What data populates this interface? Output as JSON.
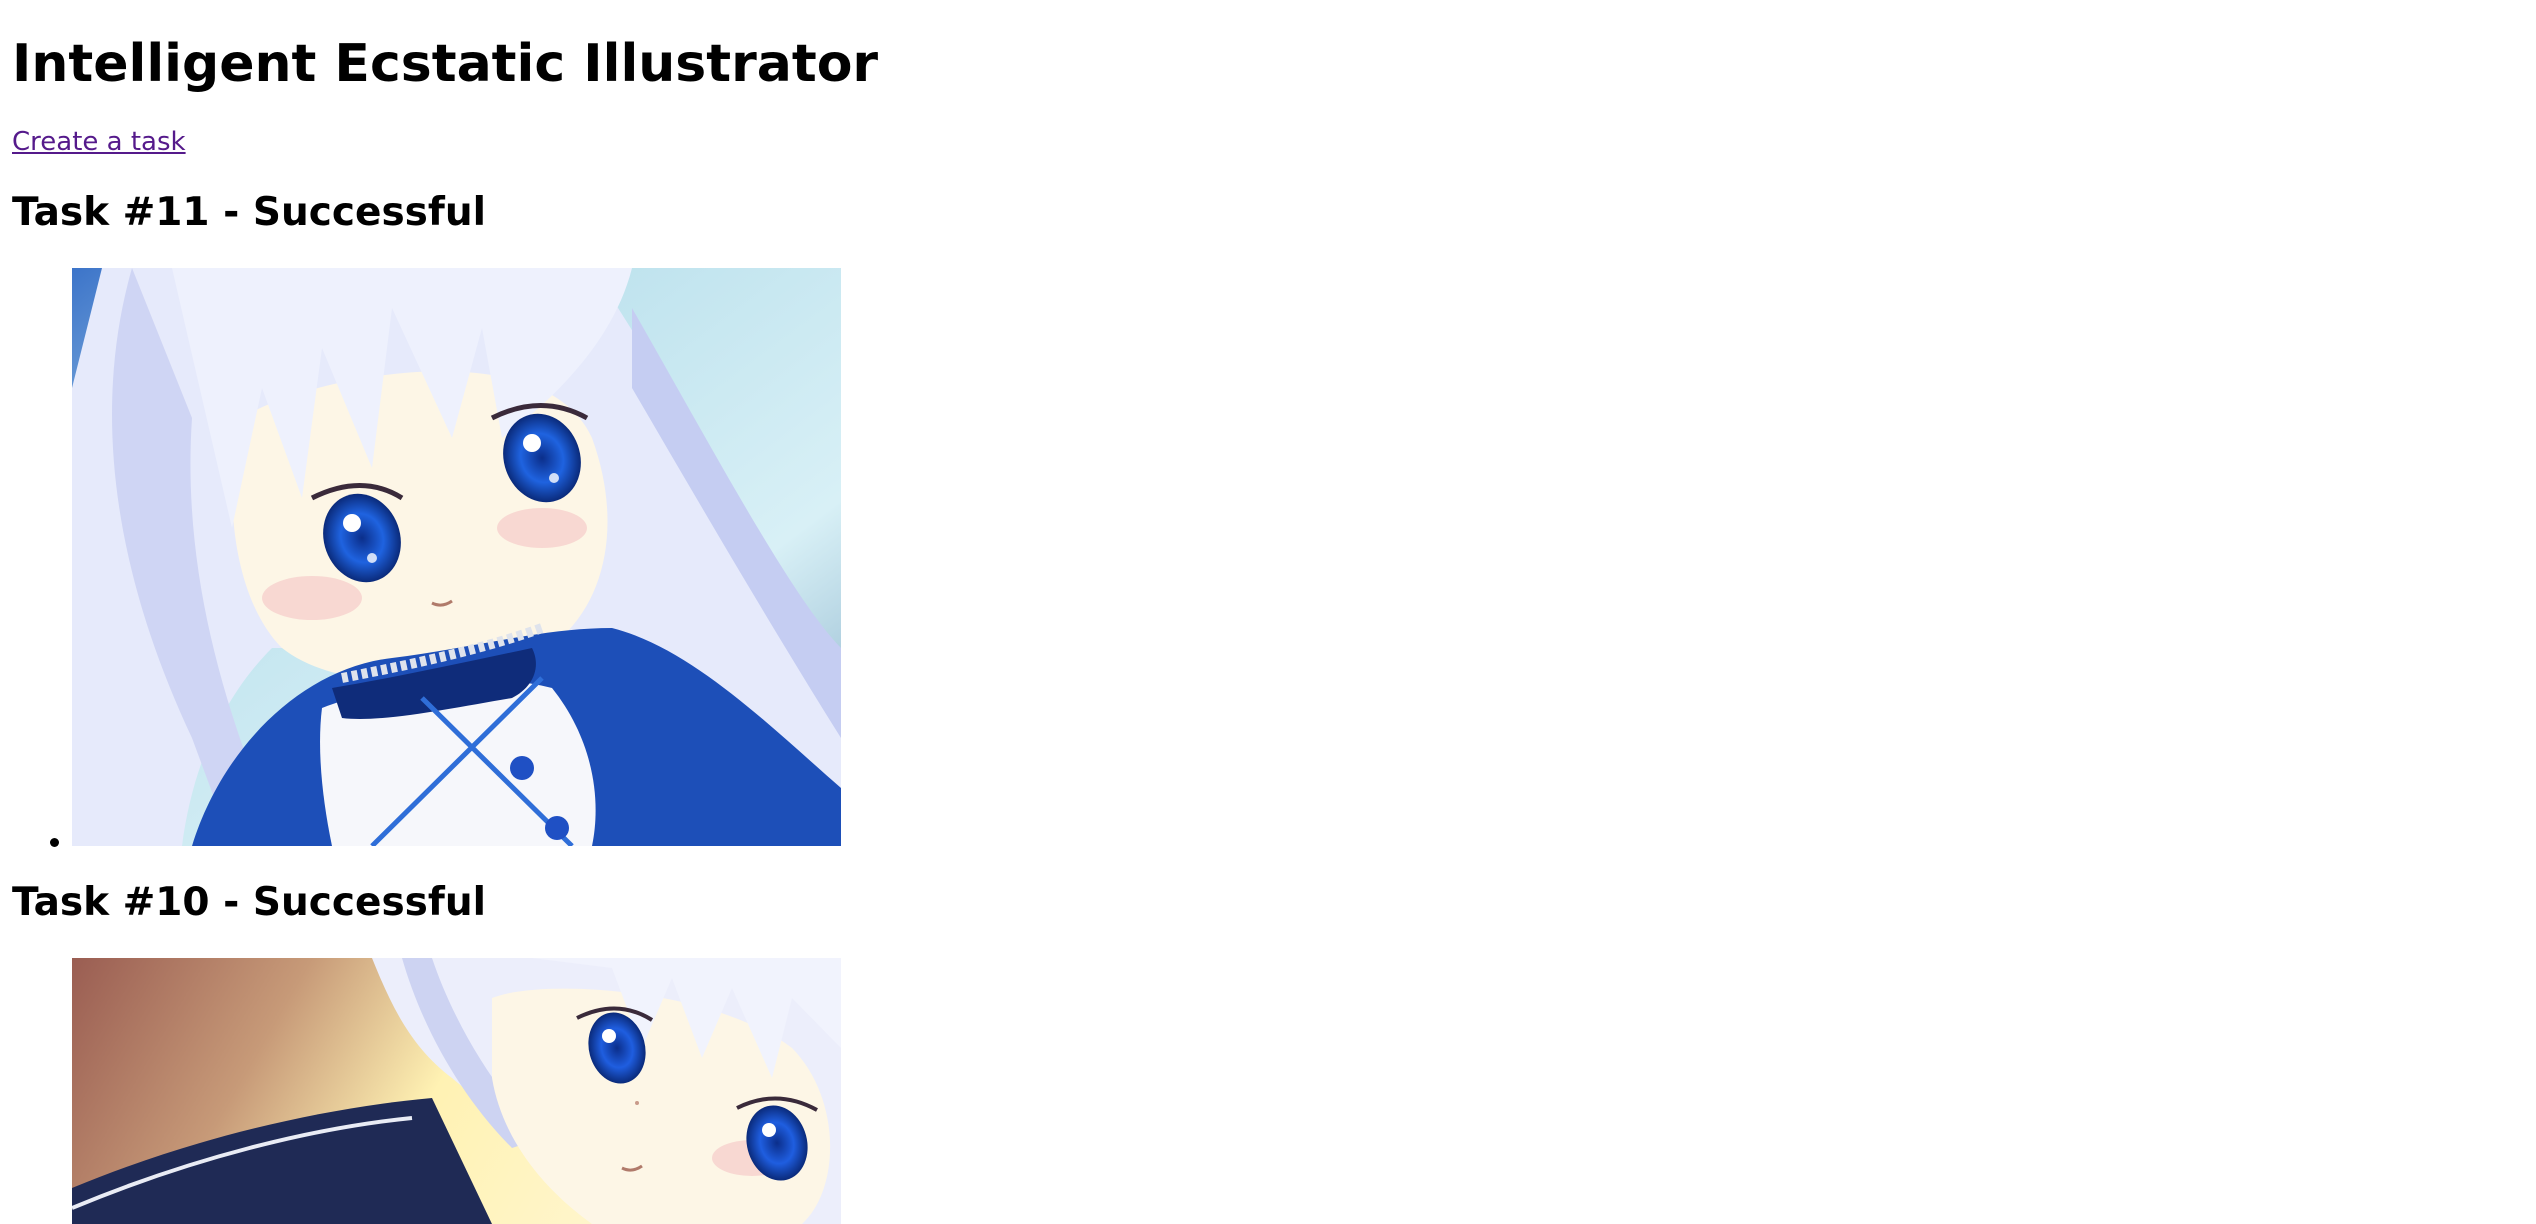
{
  "page": {
    "title": "Intelligent Ecstatic Illustrator",
    "create_link": "Create a task"
  },
  "tasks": [
    {
      "heading": "Task #11 - Successful",
      "image": {
        "subject": "anime girl with silver-white hair and blue eyes, blue and white outfit with lace collar",
        "colors": {
          "bg": "#9fc7d6",
          "hair": "#e8ecfb",
          "eyes": "#1f56d6",
          "outfit": "#1d4fb8",
          "skin": "#fdf6e6"
        }
      }
    },
    {
      "heading": "Task #10 - Successful",
      "image": {
        "subject": "anime girl with silver-white hair and blue eyes, warm brown-to-yellow gradient background, navy outfit",
        "colors": {
          "bg_start": "#9a5d52",
          "bg_end": "#fff2b3",
          "hair": "#eceefb",
          "eyes": "#1b48c9",
          "outfit": "#1f2a55",
          "skin": "#fdf6e6"
        }
      }
    }
  ]
}
